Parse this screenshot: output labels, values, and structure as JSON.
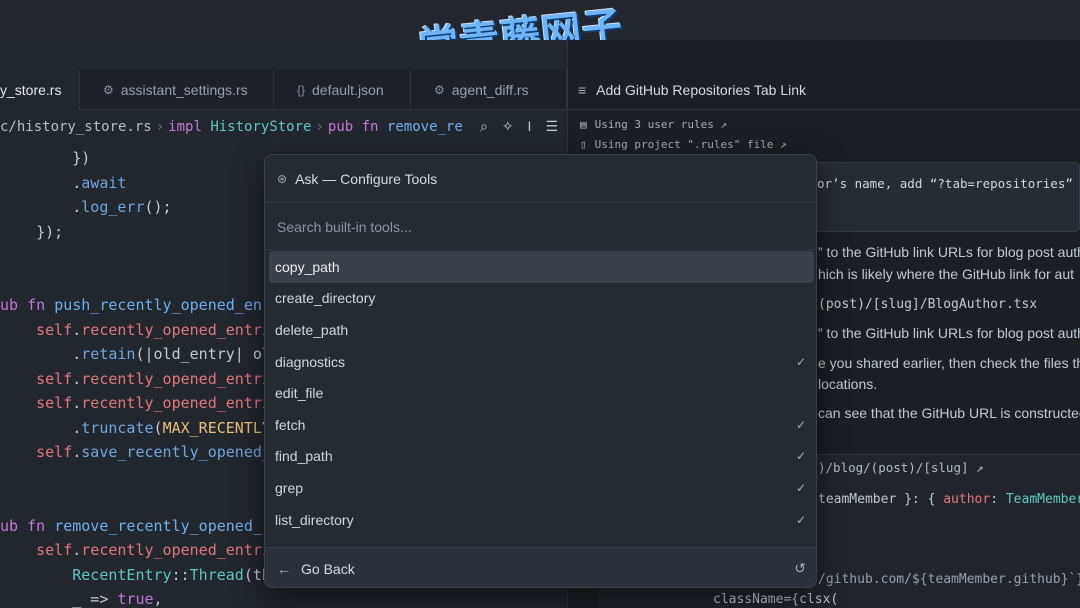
{
  "watermark": "常青藤网子",
  "editor": {
    "tabs": [
      {
        "label": "y_store.rs",
        "icon": "",
        "active": true
      },
      {
        "label": "assistant_settings.rs",
        "icon": "rust-file-icon"
      },
      {
        "label": "default.json",
        "icon": "json-file-icon"
      },
      {
        "label": "agent_diff.rs",
        "icon": "rust-file-icon"
      }
    ],
    "breadcrumb": {
      "path": "c/history_store.rs",
      "impl_kw": "impl",
      "impl_type": "HistoryStore",
      "fn_kw": "pub fn",
      "fn_name": "remove_re"
    },
    "tool_icons": [
      "search-icon",
      "sparkle-icon",
      "cursor-icon",
      "settings-sliders-icon"
    ],
    "code_lines": [
      "        })",
      "        .await",
      "        .log_err();",
      "    });",
      "",
      "",
      "ub fn push_recently_opened_en",
      "    self.recently_opened_entri",
      "        .retain(|old_entry| ol",
      "    self.recently_opened_entri",
      "    self.recently_opened_entri",
      "        .truncate(MAX_RECENTLY",
      "    self.save_recently_opened_",
      "",
      "",
      "ub fn remove_recently_opened_",
      "    self.recently_opened_entri",
      "        RecentEntry::Thread(th",
      "        _ => true,"
    ]
  },
  "panel": {
    "title": "Add GitHub Repositories Tab Link",
    "rules": [
      {
        "text": "Using 3 user rules ↗",
        "icon": "rules-icon"
      },
      {
        "text": "Using project \".rules\" file ↗",
        "icon": "file-icon"
      }
    ],
    "message": "or’s name, add “?tab=repositories” to",
    "body": [
      "” to the GitHub link URLs for blog post auth",
      "hich is likely where the GitHub link for aut",
      "(post)/[slug]/BlogAuthor.tsx",
      "” to the GitHub link URLs for blog post auth",
      "e you shared earlier, then check the files th",
      "locations.",
      "can see that the GitHub URL is constructed"
    ],
    "code_path": ")/blog/(post)/[slug] ↗",
    "code_snippet": {
      "destructure": "teamMember }: {",
      "key": "author",
      "type": "TeamMember",
      "close": "}",
      "url": "/github.com/${teamMember.github}`}",
      "classname": "className={clsx("
    }
  },
  "modal": {
    "title": "Ask — Configure Tools",
    "search_placeholder": "Search built-in tools...",
    "tools": [
      {
        "name": "copy_path",
        "checked": false,
        "selected": true
      },
      {
        "name": "create_directory",
        "checked": false
      },
      {
        "name": "delete_path",
        "checked": false
      },
      {
        "name": "diagnostics",
        "checked": true
      },
      {
        "name": "edit_file",
        "checked": false
      },
      {
        "name": "fetch",
        "checked": true
      },
      {
        "name": "find_path",
        "checked": true
      },
      {
        "name": "grep",
        "checked": true
      },
      {
        "name": "list_directory",
        "checked": true
      }
    ],
    "back_label": "Go Back",
    "check_glyph": "✓"
  }
}
